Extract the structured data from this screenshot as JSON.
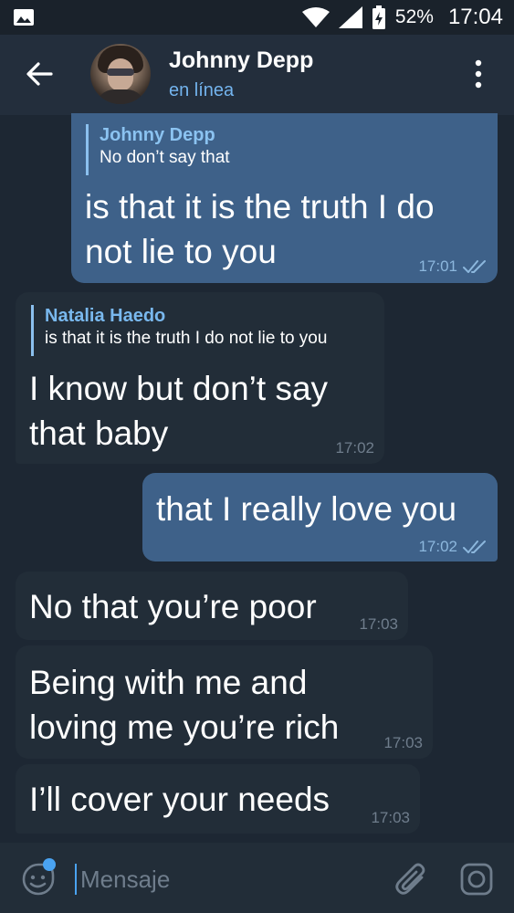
{
  "status_bar": {
    "battery_percent": "52%",
    "time": "17:04",
    "icons": [
      "image-icon",
      "wifi-icon",
      "signal-icon",
      "battery-icon"
    ]
  },
  "header": {
    "contact_name": "Johnny Depp",
    "status": "en línea",
    "icons": [
      "back-arrow-icon",
      "avatar",
      "more-vertical-icon"
    ]
  },
  "messages": [
    {
      "direction": "outgoing",
      "reply_to": {
        "name": "Johnny Depp",
        "text": "No don’t  say that"
      },
      "text_lines": [
        "is that it is the truth I do",
        "not lie to you"
      ],
      "time": "17:01",
      "status": "read"
    },
    {
      "direction": "incoming",
      "reply_to": {
        "name": "Natalia Haedo",
        "text": "is that it is the truth I do not lie to you"
      },
      "text_lines": [
        "I know but don’t say",
        "that baby"
      ],
      "time": "17:02"
    },
    {
      "direction": "outgoing",
      "text_lines": [
        "that I really love you"
      ],
      "time": "17:02",
      "status": "read"
    },
    {
      "direction": "incoming",
      "text_lines": [
        "No that you’re poor"
      ],
      "time": "17:03"
    },
    {
      "direction": "incoming",
      "text_lines": [
        "Being with me and",
        "loving me you’re rich"
      ],
      "time": "17:03"
    },
    {
      "direction": "incoming",
      "text_lines": [
        "I’ll cover your needs"
      ],
      "time": "17:03"
    }
  ],
  "composer": {
    "placeholder": "Mensaje",
    "value": "",
    "icons": [
      "sticker-emoji-icon",
      "attach-icon",
      "camera-icon"
    ]
  },
  "colors": {
    "background": "#1d2733",
    "header": "#232e3c",
    "outgoing_bubble": "#3e6189",
    "incoming_bubble": "#222d38",
    "accent": "#4aa3f1"
  }
}
